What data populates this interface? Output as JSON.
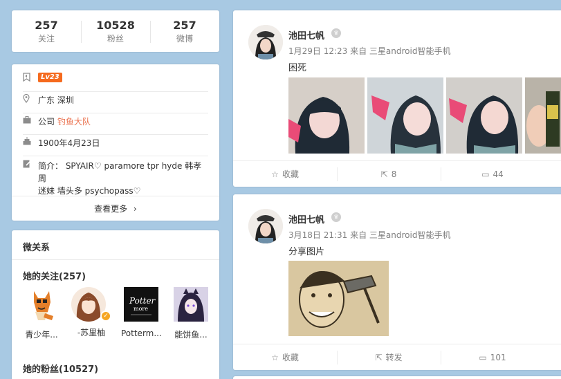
{
  "stats": [
    {
      "value": "257",
      "label": "关注"
    },
    {
      "value": "10528",
      "label": "粉丝"
    },
    {
      "value": "257",
      "label": "微博"
    }
  ],
  "profile": {
    "level": "Lv23",
    "location": "广东 深圳",
    "company_prefix": "公司 ",
    "company_name": "钓鱼大队",
    "birthday": "1900年4月23日",
    "bio_line1": "简介： SPYAIR♡ paramore tpr hyde 韩孝周",
    "bio_line2": "迷妹 墙头多 psychopass♡",
    "see_more": "查看更多"
  },
  "relations": {
    "title": "微关系",
    "following_heading": "她的关注(257)",
    "following": [
      {
        "name": "青少年..."
      },
      {
        "name": "-苏里柚"
      },
      {
        "name": "Potterm..."
      },
      {
        "name": "能饼鱼..."
      }
    ],
    "fans_heading": "她的粉丝(10527)"
  },
  "posts": [
    {
      "author": "池田七帆",
      "meta": "1月29日 12:23 来自 三星android智能手机",
      "text": "困死",
      "actions": [
        {
          "icon": "star-icon",
          "label": "收藏"
        },
        {
          "icon": "share-icon",
          "label": "8"
        },
        {
          "icon": "comment-icon",
          "label": "44"
        }
      ]
    },
    {
      "author": "池田七帆",
      "meta": "3月18日 21:31 来自 三星android智能手机",
      "text": "分享图片",
      "actions": [
        {
          "icon": "star-icon",
          "label": "收藏"
        },
        {
          "icon": "share-icon",
          "label": "转发"
        },
        {
          "icon": "comment-icon",
          "label": "101"
        }
      ]
    }
  ],
  "colors": {
    "background": "#a8c9e3",
    "accent": "#eb7350",
    "level_badge": "#f56a1e",
    "verified": "#f6a623"
  }
}
